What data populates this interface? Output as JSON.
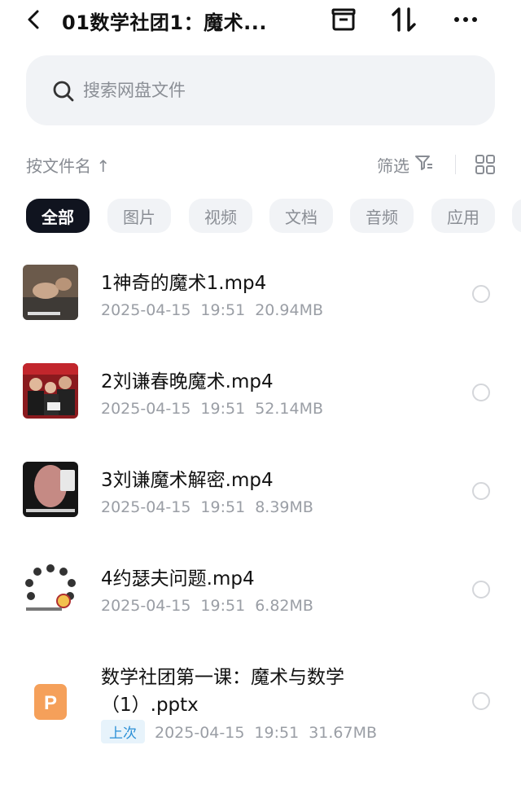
{
  "header": {
    "title": "01数学社团1：魔术...",
    "icons": [
      "back-icon",
      "archive-icon",
      "sort-swap-icon",
      "more-icon"
    ]
  },
  "search": {
    "placeholder": "搜索网盘文件"
  },
  "sort": {
    "label": "按文件名 ↑",
    "filter_label": "筛选"
  },
  "tabs": [
    {
      "label": "全部",
      "active": true
    },
    {
      "label": "图片"
    },
    {
      "label": "视频"
    },
    {
      "label": "文档"
    },
    {
      "label": "音频"
    },
    {
      "label": "应用"
    }
  ],
  "files": [
    {
      "name": "1神奇的魔术1.mp4",
      "date": "2025-04-15",
      "time": "19:51",
      "size": "20.94MB",
      "type": "video"
    },
    {
      "name": "2刘谦春晚魔术.mp4",
      "date": "2025-04-15",
      "time": "19:51",
      "size": "52.14MB",
      "type": "video"
    },
    {
      "name": "3刘谦魔术解密.mp4",
      "date": "2025-04-15",
      "time": "19:51",
      "size": "8.39MB",
      "type": "video"
    },
    {
      "name": "4约瑟夫问题.mp4",
      "date": "2025-04-15",
      "time": "19:51",
      "size": "6.82MB",
      "type": "video"
    },
    {
      "name_line1": "数学社团第一课：魔术与数学",
      "name_line2": "（1）.pptx",
      "badge": "上次",
      "date": "2025-04-15",
      "time": "19:51",
      "size": "31.67MB",
      "type": "pptx"
    }
  ],
  "colors": {
    "active_chip": "#10141f",
    "pptx_icon": "#f5a05a",
    "badge_text": "#2a8fd6"
  }
}
